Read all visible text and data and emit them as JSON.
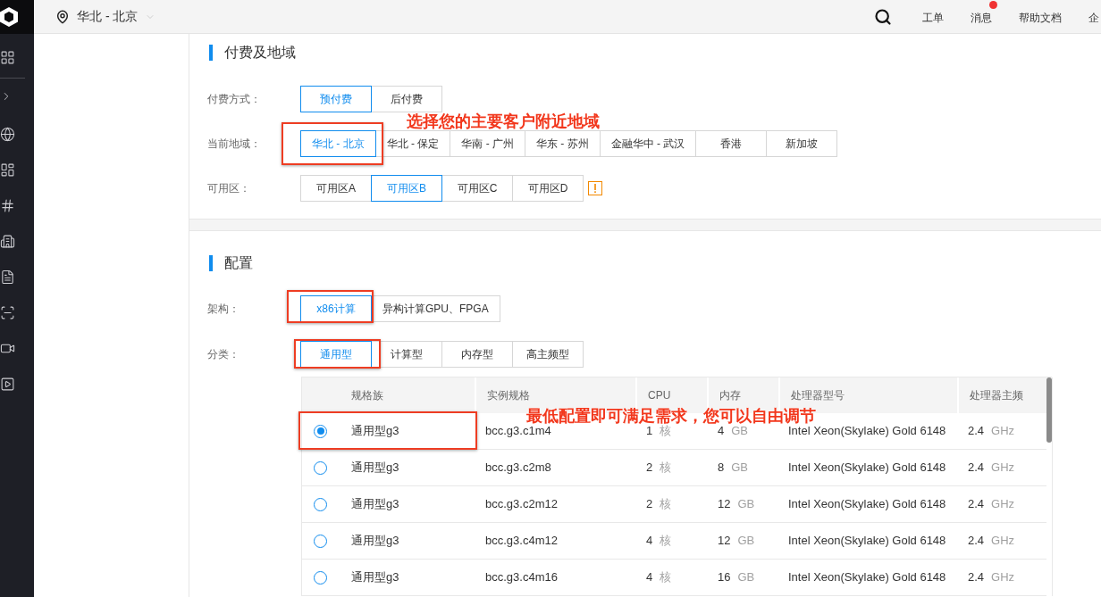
{
  "topbar": {
    "region": "华北 - 北京",
    "nav": [
      {
        "label": "工单",
        "badge": false
      },
      {
        "label": "消息",
        "badge": true
      },
      {
        "label": "帮助文档",
        "badge": false
      },
      {
        "label": "企",
        "badge": false
      }
    ]
  },
  "billing": {
    "title": "付费及地域",
    "payment": {
      "label": "付费方式：",
      "options": [
        {
          "label": "预付费",
          "selected": true,
          "highlighted": false
        },
        {
          "label": "后付费",
          "selected": false,
          "highlighted": false
        }
      ]
    },
    "region": {
      "label": "当前地域：",
      "callout": "选择您的主要客户附近地域",
      "options": [
        {
          "label": "华北 - 北京",
          "selected": true,
          "highlighted": true
        },
        {
          "label": "华北 - 保定",
          "selected": false,
          "highlighted": false
        },
        {
          "label": "华南 - 广州",
          "selected": false,
          "highlighted": false
        },
        {
          "label": "华东 - 苏州",
          "selected": false,
          "highlighted": false
        },
        {
          "label": "金融华中 - 武汉",
          "selected": false,
          "highlighted": false
        },
        {
          "label": "香港",
          "selected": false,
          "highlighted": false
        },
        {
          "label": "新加坡",
          "selected": false,
          "highlighted": false
        }
      ]
    },
    "zone": {
      "label": "可用区：",
      "warning": true,
      "options": [
        {
          "label": "可用区A",
          "selected": false,
          "highlighted": false
        },
        {
          "label": "可用区B",
          "selected": true,
          "highlighted": false
        },
        {
          "label": "可用区C",
          "selected": false,
          "highlighted": false
        },
        {
          "label": "可用区D",
          "selected": false,
          "highlighted": false
        }
      ]
    }
  },
  "config": {
    "title": "配置",
    "architecture": {
      "label": "架构：",
      "options": [
        {
          "label": "x86计算",
          "selected": true,
          "highlighted": true
        },
        {
          "label": "异构计算GPU、FPGA",
          "selected": false,
          "highlighted": false
        }
      ]
    },
    "category": {
      "label": "分类：",
      "options": [
        {
          "label": "通用型",
          "selected": true,
          "highlighted": true
        },
        {
          "label": "计算型",
          "selected": false,
          "highlighted": false
        },
        {
          "label": "内存型",
          "selected": false,
          "highlighted": false
        },
        {
          "label": "高主频型",
          "selected": false,
          "highlighted": false
        }
      ]
    },
    "table": {
      "callout": "最低配置即可满足需求，您可以自由调节",
      "columns": [
        "规格族",
        "实例规格",
        "CPU",
        "内存",
        "处理器型号",
        "处理器主频"
      ],
      "rows": [
        {
          "selected": true,
          "highlighted": true,
          "family": "通用型g3",
          "spec": "bcc.g3.c1m4",
          "cpu": "1",
          "cpu_unit": "核",
          "memory": "4",
          "memory_unit": "GB",
          "processor": "Intel Xeon(Skylake) Gold 6148",
          "frequency": "2.4",
          "frequency_unit": "GHz"
        },
        {
          "selected": false,
          "highlighted": false,
          "family": "通用型g3",
          "spec": "bcc.g3.c2m8",
          "cpu": "2",
          "cpu_unit": "核",
          "memory": "8",
          "memory_unit": "GB",
          "processor": "Intel Xeon(Skylake) Gold 6148",
          "frequency": "2.4",
          "frequency_unit": "GHz"
        },
        {
          "selected": false,
          "highlighted": false,
          "family": "通用型g3",
          "spec": "bcc.g3.c2m12",
          "cpu": "2",
          "cpu_unit": "核",
          "memory": "12",
          "memory_unit": "GB",
          "processor": "Intel Xeon(Skylake) Gold 6148",
          "frequency": "2.4",
          "frequency_unit": "GHz"
        },
        {
          "selected": false,
          "highlighted": false,
          "family": "通用型g3",
          "spec": "bcc.g3.c4m12",
          "cpu": "4",
          "cpu_unit": "核",
          "memory": "12",
          "memory_unit": "GB",
          "processor": "Intel Xeon(Skylake) Gold 6148",
          "frequency": "2.4",
          "frequency_unit": "GHz"
        },
        {
          "selected": false,
          "highlighted": false,
          "family": "通用型g3",
          "spec": "bcc.g3.c4m16",
          "cpu": "4",
          "cpu_unit": "核",
          "memory": "16",
          "memory_unit": "GB",
          "processor": "Intel Xeon(Skylake) Gold 6148",
          "frequency": "2.4",
          "frequency_unit": "GHz"
        }
      ]
    }
  }
}
